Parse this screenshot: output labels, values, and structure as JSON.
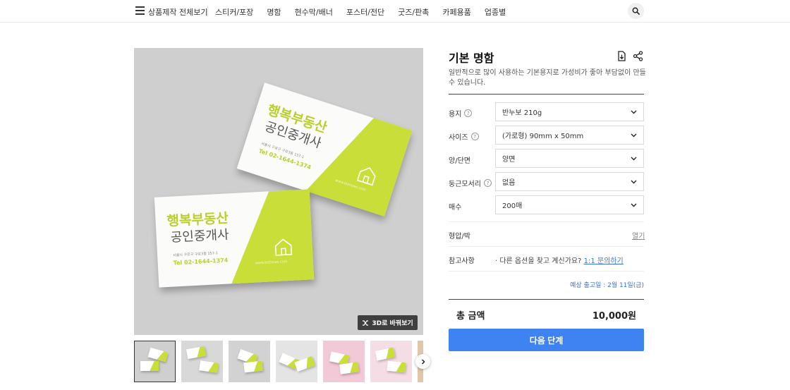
{
  "nav": {
    "all_products": "상품제작 전체보기",
    "menu": [
      "스티커/포장",
      "명함",
      "현수막/배너",
      "포스터/전단",
      "굿즈/판촉",
      "카페용품",
      "업종별"
    ]
  },
  "gallery": {
    "card_title_line1": "행복부동산",
    "card_title_line2": "공인중개사",
    "card_address": "서울시 구로구 구로3동 157-1",
    "card_phone": "Tel 02-1644-1374",
    "card_web": "www.bizhows.com",
    "switch_3d_label": "3D로 바꿔보기",
    "thumbnails": [
      {
        "bg": "#cfcfcf",
        "selected": true
      },
      {
        "bg": "#d8d8d8",
        "selected": false
      },
      {
        "bg": "#d2d2d2",
        "selected": false
      },
      {
        "bg": "#e4e4e4",
        "selected": false
      },
      {
        "bg": "#f2c9d6",
        "selected": false
      },
      {
        "bg": "#f5dde6",
        "selected": false
      },
      {
        "bg": "#e0c7a8",
        "selected": false
      }
    ]
  },
  "product": {
    "title": "기본 명함",
    "description": "일반적으로 많이 사용하는 기본용지로 가성비가 좋아 부담없이 만들 수 있습니다.",
    "options": [
      {
        "label": "용지",
        "help": true,
        "value": "반누보 210g"
      },
      {
        "label": "사이즈",
        "help": true,
        "value": "(가로형) 90mm x 50mm"
      },
      {
        "label": "양/단면",
        "help": false,
        "value": "양면"
      },
      {
        "label": "둥근모서리",
        "help": true,
        "value": "없음"
      },
      {
        "label": "매수",
        "help": false,
        "value": "200매"
      }
    ],
    "foil_label": "형압/박",
    "foil_toggle": "열기",
    "note_label": "참고사항",
    "note_text": "· 다른 옵션을 찾고 계신가요?",
    "note_link": "1:1 문의하기",
    "ship_date": "예상 출고일 : 2월 11일(금)",
    "total_label": "총 금액",
    "total_value": "10,000원",
    "next_button": "다음 단계"
  },
  "colors": {
    "accent": "#3f82f2",
    "link": "#3b73d4",
    "card_lime": "#c9de38"
  }
}
